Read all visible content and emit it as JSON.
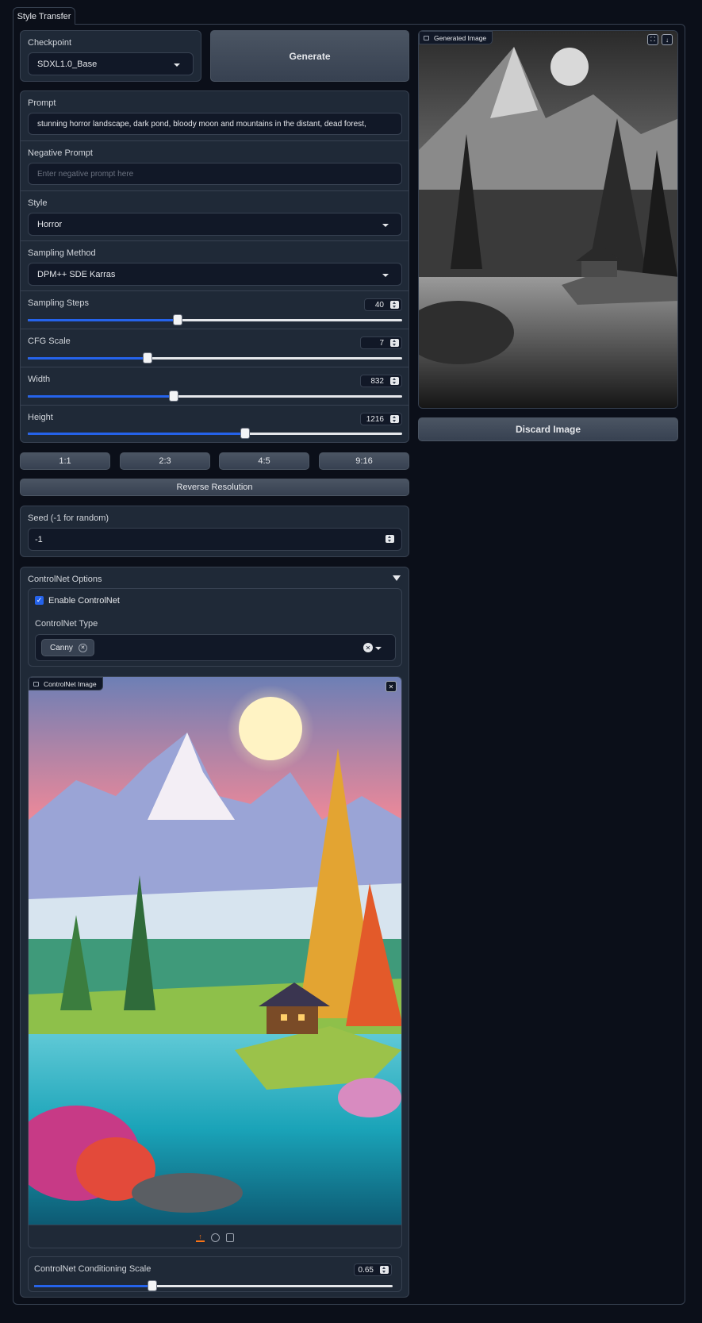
{
  "tab": {
    "label": "Style Transfer"
  },
  "checkpoint": {
    "label": "Checkpoint",
    "value": "SDXL1.0_Base"
  },
  "generate": {
    "label": "Generate"
  },
  "prompt": {
    "label": "Prompt",
    "value": "stunning horror landscape, dark pond, bloody moon and mountains  in the distant, dead forest,"
  },
  "negative_prompt": {
    "label": "Negative Prompt",
    "placeholder": "Enter negative prompt here"
  },
  "style": {
    "label": "Style",
    "value": "Horror"
  },
  "sampling_method": {
    "label": "Sampling Method",
    "value": "DPM++ SDE Karras"
  },
  "sliders": {
    "steps": {
      "label": "Sampling Steps",
      "value": "40",
      "fraction": 0.4
    },
    "cfg": {
      "label": "CFG Scale",
      "value": "7",
      "fraction": 0.32
    },
    "width": {
      "label": "Width",
      "value": "832",
      "fraction": 0.39
    },
    "height": {
      "label": "Height",
      "value": "1216",
      "fraction": 0.58
    }
  },
  "ratios": [
    "1:1",
    "2:3",
    "4:5",
    "9:16"
  ],
  "reverse": {
    "label": "Reverse Resolution"
  },
  "seed": {
    "label": "Seed (-1 for random)",
    "value": "-1"
  },
  "controlnet": {
    "title": "ControlNet Options",
    "enable_label": "Enable ControlNet",
    "enabled": true,
    "type_label": "ControlNet Type",
    "type_value": "Canny",
    "image_label": "ControlNet Image",
    "scale_label": "ControlNet Conditioning Scale",
    "scale_value": "0.65",
    "scale_fraction": 0.33
  },
  "generated": {
    "label": "Generated Image"
  },
  "discard": {
    "label": "Discard Image"
  },
  "colors": {
    "accent": "#2563eb",
    "bg": "#0b0f19",
    "panel": "#1f2937",
    "border": "#374151"
  }
}
